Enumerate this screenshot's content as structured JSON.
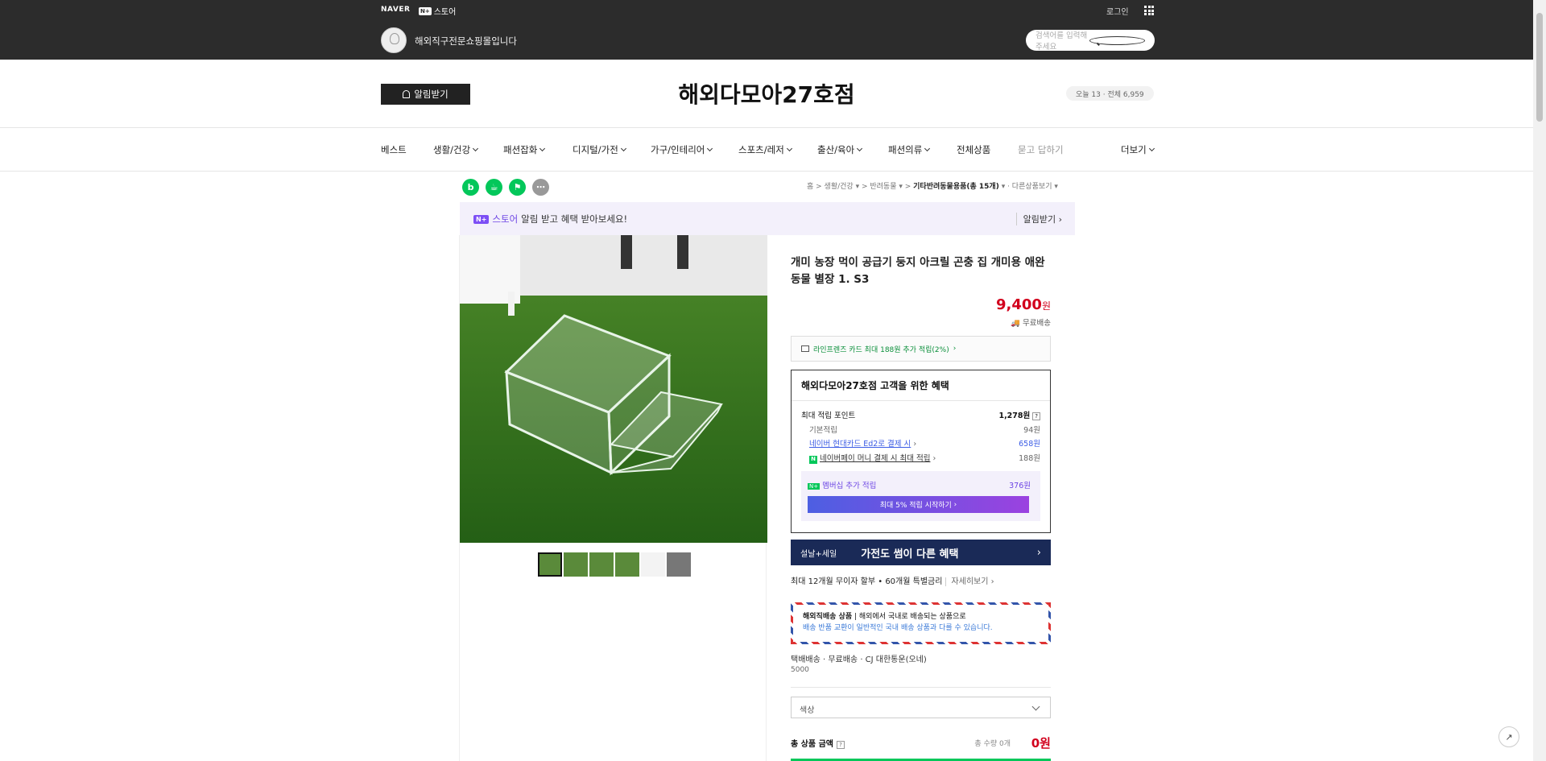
{
  "topbar": {
    "brand": "NAVER",
    "store_label": "스토어",
    "store_badge": "N+",
    "login": "로그인",
    "store_name": "해외직구전문쇼핑몰입니다",
    "search_placeholder": "검색어를 입력해주세요"
  },
  "header": {
    "notify_label": "알림받기",
    "store_title": "해외다모아27호점",
    "visits": "오늘 13 · 전체 6,959"
  },
  "nav": {
    "items": [
      {
        "label": "베스트"
      },
      {
        "label": "생활/건강"
      },
      {
        "label": "패션잡화"
      },
      {
        "label": "디지털/가전"
      },
      {
        "label": "가구/인테리어"
      },
      {
        "label": "스포츠/레저"
      },
      {
        "label": "출산/육아"
      },
      {
        "label": "패션의류"
      },
      {
        "label": "전체상품"
      },
      {
        "label": "묻고 답하기"
      },
      {
        "label": "더보기"
      }
    ]
  },
  "breadcrumb": {
    "home": "홈",
    "c1": "생활/건강",
    "c2": "반려동물",
    "c3": "기타반려동물용품(총 15개)",
    "c4": "다른상품보기"
  },
  "promo": {
    "tag": "N+",
    "store": "스토어",
    "text": "알림 받고 혜택 받아보세요!",
    "action": "알림받기"
  },
  "product": {
    "title": "개미 농장 먹이 공급기 둥지 아크릴 곤충 집 개미용 애완 동물 별장 1. S3",
    "price": "9,400",
    "price_unit": "원",
    "shipping": "무료배송",
    "card_benefit": "라인프렌즈 카드 최대 188원 추가 적립(2%)"
  },
  "benefit": {
    "heading": "해외다모아27호점 고객을 위한 혜택",
    "max_points_label": "최대 적립 포인트",
    "max_points": "1,278원",
    "basic_label": "기본적립",
    "basic_value": "94원",
    "hyundai_label": "네이버 현대카드 Ed2로 결제 시",
    "hyundai_value": "658원",
    "npay_label": "네이버페이 머니 결제 시 최대 적립",
    "npay_value": "188원",
    "member_label": "멤버십 추가 적립",
    "member_value": "376원",
    "member_button": "최대 5% 적립 시작하기"
  },
  "banner": {
    "left": "설날+세일",
    "main": "가전도 썸이 다른 혜택"
  },
  "installment": {
    "text": "최대 12개월 무이자 할부 • 60개월 특별금리",
    "more": "자세히보기"
  },
  "overseas": {
    "title": "해외직배송 상품",
    "line1": "해외에서 국내로 배송되는 상품으로",
    "line2": "배송 반품 교환이 일반적인 국내 배송 상품과 다를 수 있습니다."
  },
  "delivery": {
    "text": "택배배송 · 무료배송 · CJ 대한통운(오네)",
    "fee": "5000"
  },
  "options": {
    "select_label": "색상"
  },
  "total": {
    "label": "총 상품 금액",
    "qty": "총 수량 0개",
    "amount": "0원"
  }
}
